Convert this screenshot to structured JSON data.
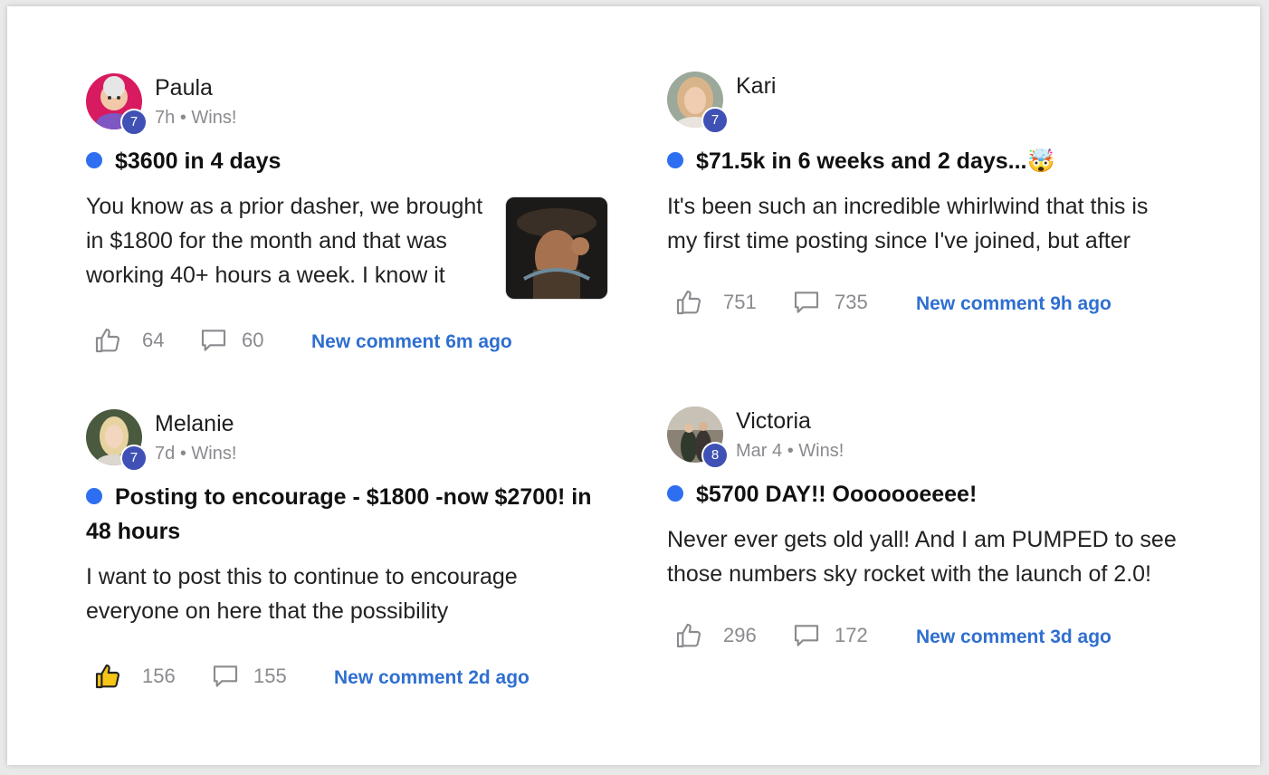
{
  "posts": [
    {
      "author": "Paula",
      "level": "7",
      "time": "7h",
      "separator": "•",
      "category": "Wins!",
      "title": "$3600 in 4 days",
      "body": "You know as a prior dasher, we brought in $1800 for the month and that was working 40+ hours a week. I know it",
      "likes": "64",
      "comments": "60",
      "new_comment": "New comment 6m ago"
    },
    {
      "author": "Kari",
      "level": "7",
      "title": "$71.5k in 6 weeks and 2 days...🤯",
      "body": "It's been such an incredible whirlwind that this is my first time posting since I've joined, but after",
      "likes": "751",
      "comments": "735",
      "new_comment": "New comment 9h ago"
    },
    {
      "author": "Melanie",
      "level": "7",
      "time": "7d",
      "separator": "•",
      "category": "Wins!",
      "title": "Posting to encourage - $1800 -now $2700! in 48 hours",
      "body": "I want to post this to continue to encourage everyone on here that the possibility",
      "likes": "156",
      "comments": "155",
      "new_comment": "New comment 2d ago",
      "liked": true
    },
    {
      "author": "Victoria",
      "level": "8",
      "time": "Mar 4",
      "separator": "•",
      "category": "Wins!",
      "title": "$5700 DAY!! Ooooooeeee!",
      "body": "Never ever gets old yall! And I am PUMPED to see those numbers sky rocket with the launch of 2.0!",
      "likes": "296",
      "comments": "172",
      "new_comment": "New comment 3d ago"
    }
  ],
  "colors": {
    "accent": "#2f6fd0",
    "unread_dot": "#2d6ff0",
    "level_badge": "#3f51b5",
    "muted": "#8a8a8f",
    "liked_fill": "#f5c518"
  },
  "icons": {
    "like": "thumbs-up-icon",
    "comment": "comment-bubble-icon"
  }
}
